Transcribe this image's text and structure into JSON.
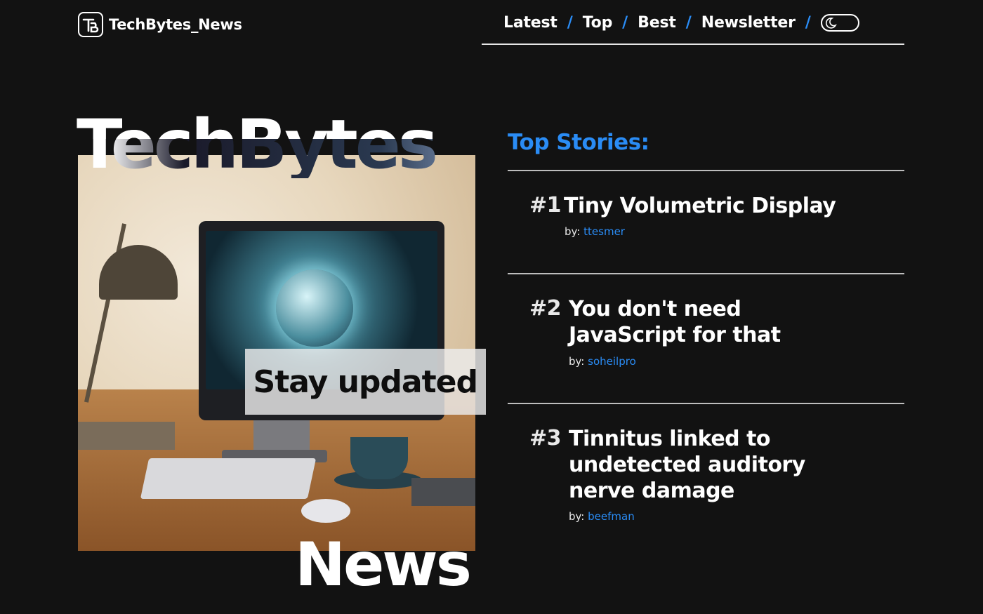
{
  "header": {
    "logo_text": "TechBytes_News",
    "nav": [
      {
        "label": "Latest"
      },
      {
        "label": "Top"
      },
      {
        "label": "Best"
      },
      {
        "label": "Newsletter"
      }
    ],
    "separator": "/",
    "theme_toggle_icon": "moon-icon"
  },
  "hero": {
    "title_top": "TechBytes",
    "tagline": "Stay updated",
    "title_bottom": "News"
  },
  "top_stories": {
    "heading": "Top Stories:",
    "by_label": "by:",
    "items": [
      {
        "rank": "#1",
        "title": "Tiny Volumetric Display",
        "author": "ttesmer"
      },
      {
        "rank": "#2",
        "title": "You don't need JavaScript for that",
        "author": "soheilpro"
      },
      {
        "rank": "#3",
        "title": "Tinnitus linked to undetected auditory nerve damage",
        "author": "beefman"
      }
    ]
  },
  "colors": {
    "background": "#121212",
    "accent": "#2a8cf5",
    "text": "#ffffff"
  }
}
